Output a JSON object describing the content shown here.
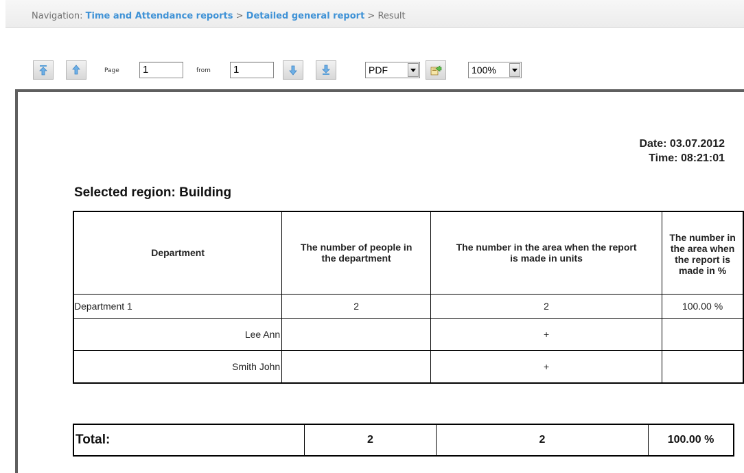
{
  "navigation": {
    "prefix": "Navigation:",
    "link1": "Time and Attendance reports",
    "sep1": ">",
    "link2": "Detailed general report",
    "sep2": ">",
    "current": "Result"
  },
  "toolbar": {
    "page_label": "Page",
    "page_value": "1",
    "from_label": "from",
    "from_value": "1",
    "format_value": "PDF",
    "zoom_value": "100%",
    "icons": [
      "first-page-icon",
      "previous-page-icon",
      "next-page-icon",
      "last-page-icon",
      "export-icon"
    ]
  },
  "report": {
    "date": "Date: 03.07.2012",
    "time": "Time: 08:21:01",
    "region": "Selected region: Building",
    "columns": [
      "Department",
      "The number of people in the department",
      "The number in the area when the report is made in units",
      "The number in the area when the report is made in %"
    ],
    "department": {
      "name": "Department 1",
      "people": "2",
      "units": "2",
      "percent": "100.00 %"
    },
    "employees": [
      {
        "name": "Lee Ann",
        "present": "+"
      },
      {
        "name": "Smith John",
        "present": "+"
      }
    ],
    "total": {
      "label": "Total:",
      "people": "2",
      "units": "2",
      "percent": "100.00 %"
    }
  },
  "colors": {
    "link": "#3f92d6",
    "frame": "#5f5f5f"
  }
}
